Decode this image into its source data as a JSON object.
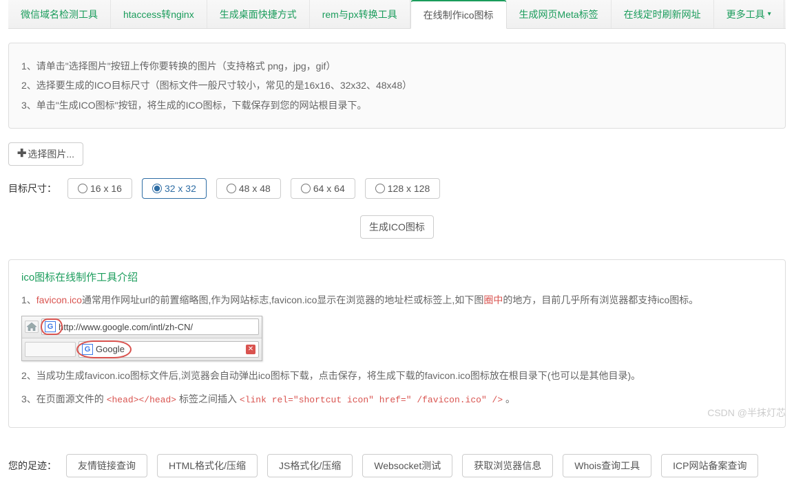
{
  "tabs": [
    {
      "label": "微信域名检测工具"
    },
    {
      "label": "htaccess转nginx"
    },
    {
      "label": "生成桌面快捷方式"
    },
    {
      "label": "rem与px转换工具"
    },
    {
      "label": "在线制作ico图标"
    },
    {
      "label": "生成网页Meta标签"
    },
    {
      "label": "在线定时刷新网址"
    },
    {
      "label": "更多工具"
    }
  ],
  "caret": "▾",
  "active_tab_index": 4,
  "instructions": [
    "1、请单击\"选择图片\"按钮上传你要转换的图片（支持格式 png，jpg，gif）",
    "2、选择要生成的ICO目标尺寸（图标文件一般尺寸较小，常见的是16x16、32x32、48x48）",
    "3、单击\"生成ICO图标\"按钮，将生成的ICO图标，下载保存到您的网站根目录下。"
  ],
  "choose_button": "选择图片...",
  "plus_glyph": "✚",
  "size_label": "目标尺寸：",
  "sizes": [
    {
      "label": "16 x 16"
    },
    {
      "label": "32 x 32"
    },
    {
      "label": "48 x 48"
    },
    {
      "label": "64 x 64"
    },
    {
      "label": "128 x 128"
    }
  ],
  "selected_size_index": 1,
  "generate_button": "生成ICO图标",
  "intro_title": "ico图标在线制作工具介绍",
  "intro_line1_prefix": "1、",
  "intro_line1_hl1": "favicon.ico",
  "intro_line1_mid": "通常用作网址url的前置缩略图,作为网站标志,favicon.ico显示在浏览器的地址栏或标签上,如下图",
  "intro_line1_hl2": "圈中",
  "intro_line1_suffix": "的地方，目前几乎所有浏览器都支持ico图标。",
  "demo_url": "http://www.google.com/intl/zh-CN/",
  "demo_tab_title": "Google",
  "fav_glyph": "G",
  "intro_line2": "2、当成功生成favicon.ico图标文件后,浏览器会自动弹出ico图标下载，点击保存，将生成下载的favicon.ico图标放在根目录下(也可以是其他目录)。",
  "intro_line3_prefix": "3、在页面源文件的 ",
  "intro_line3_code1": "<head></head>",
  "intro_line3_mid": " 标签之间插入 ",
  "intro_line3_code2": "<link rel=\"shortcut icon\" href=\" /favicon.ico\" />",
  "intro_line3_suffix": " 。",
  "footer_label": "您的足迹：",
  "footer_links": [
    {
      "label": "友情链接查询"
    },
    {
      "label": "HTML格式化/压缩"
    },
    {
      "label": "JS格式化/压缩"
    },
    {
      "label": "Websocket测试"
    },
    {
      "label": "获取浏览器信息"
    },
    {
      "label": "Whois查询工具"
    },
    {
      "label": "ICP网站备案查询"
    }
  ],
  "watermark": "CSDN @半抹灯芯"
}
